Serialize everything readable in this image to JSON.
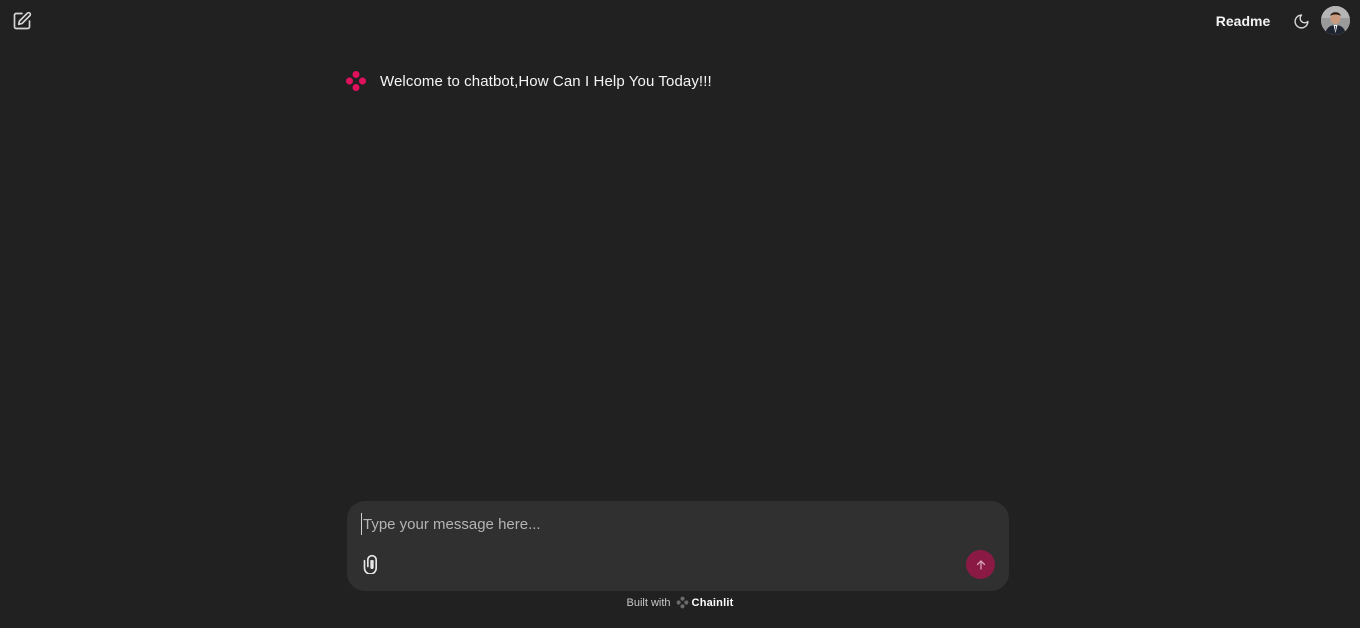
{
  "header": {
    "new_chat_icon": "edit-icon",
    "readme_label": "Readme",
    "theme_icon": "moon-icon",
    "avatar_icon": "user-avatar"
  },
  "chat": {
    "bot_icon": "chainlit-logo-icon",
    "welcome_message": "Welcome to chatbot,How Can I Help You Today!!!"
  },
  "composer": {
    "placeholder": "Type your message here...",
    "value": "",
    "attach_icon": "paperclip-icon",
    "send_icon": "arrow-up-icon"
  },
  "footer": {
    "built_with": "Built with",
    "brand": "Chainlit"
  },
  "colors": {
    "background": "#212121",
    "composer_bg": "#303030",
    "accent": "#e0105c",
    "send_button": "#8a1a44"
  }
}
